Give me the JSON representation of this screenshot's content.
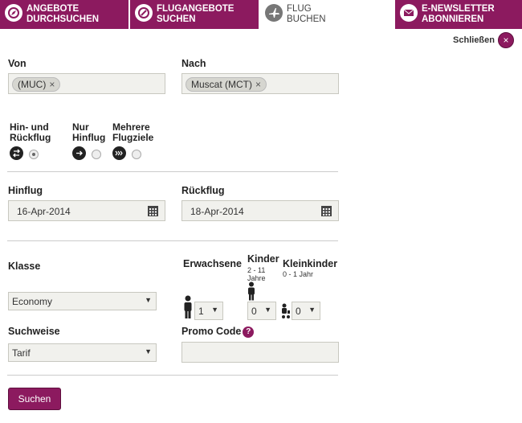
{
  "tabs": [
    {
      "icon": "compass-icon",
      "label": "ANGEBOTE\nDURCHSUCHEN"
    },
    {
      "icon": "percent-icon",
      "label": "FLUGANGEBOTE\nSUCHEN"
    },
    {
      "icon": "airplane-icon",
      "label": "FLUG\nBUCHEN"
    },
    {
      "icon": "envelope-icon",
      "label": "E-NEWSLETTER\nABONNIEREN"
    }
  ],
  "close_label": "Schließen",
  "from": {
    "label": "Von",
    "chip": "(MUC)"
  },
  "to": {
    "label": "Nach",
    "chip": "Muscat (MCT)"
  },
  "trip_types": [
    {
      "label": "Hin- und\nRückflug",
      "selected": true
    },
    {
      "label": "Nur\nHinflug",
      "selected": false
    },
    {
      "label": "Mehrere\nFlugziele",
      "selected": false
    }
  ],
  "outbound": {
    "label": "Hinflug",
    "value": "16-Apr-2014"
  },
  "return": {
    "label": "Rückflug",
    "value": "18-Apr-2014"
  },
  "class": {
    "label": "Klasse",
    "value": "Economy"
  },
  "adults": {
    "label": "Erwachsene",
    "value": "1"
  },
  "children": {
    "label": "Kinder",
    "sub": "2 - 11\nJahre",
    "value": "0"
  },
  "infants": {
    "label": "Kleinkinder",
    "sub": "0 - 1 Jahr",
    "value": "0"
  },
  "search_mode": {
    "label": "Suchweise",
    "value": "Tarif"
  },
  "promo": {
    "label": "Promo Code",
    "help": "?",
    "value": ""
  },
  "search_button": "Suchen",
  "colors": {
    "brand": "#8c1a5f"
  }
}
